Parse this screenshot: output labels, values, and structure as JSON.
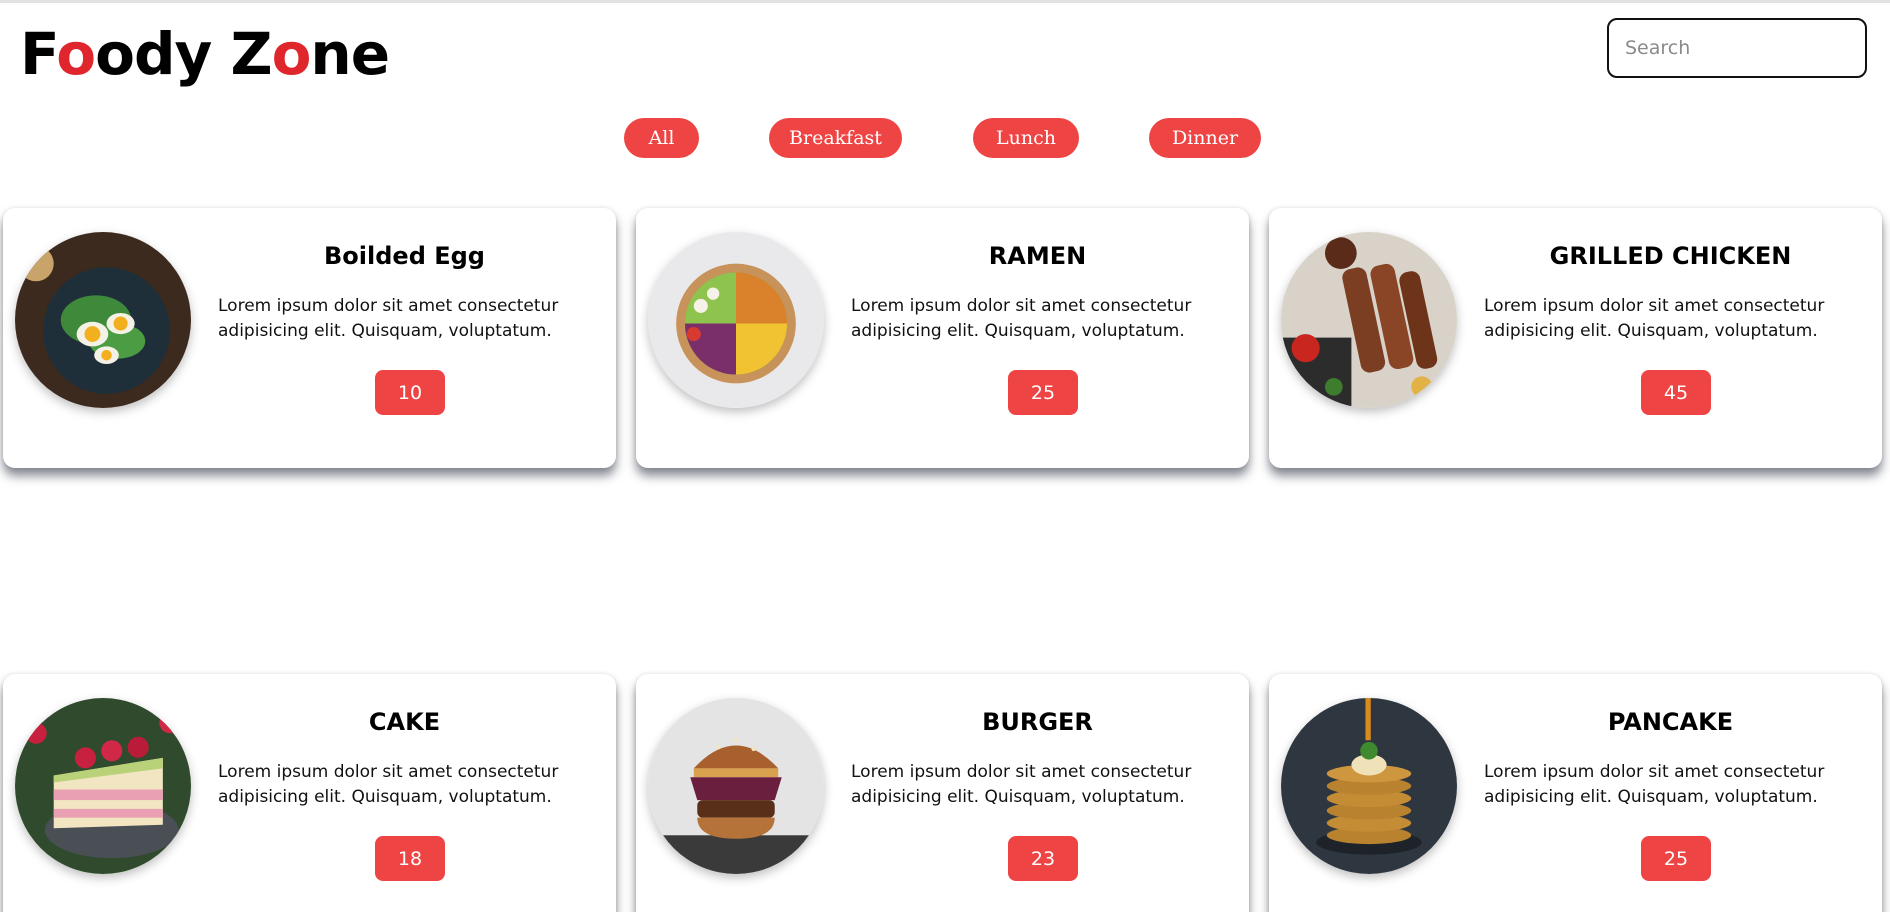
{
  "header": {
    "logo_parts": [
      "F",
      "o",
      "ody Z",
      "o",
      "ne"
    ],
    "search_placeholder": "Search"
  },
  "filters": [
    "All",
    "Breakfast",
    "Lunch",
    "Dinner"
  ],
  "cards": [
    {
      "title": "Boilded Egg",
      "description": "Lorem ipsum dolor sit amet consectetur adipisicing elit. Quisquam, voluptatum.",
      "price": "10",
      "image_icon": "boiled-egg-image"
    },
    {
      "title": "RAMEN",
      "description": "Lorem ipsum dolor sit amet consectetur adipisicing elit. Quisquam, voluptatum.",
      "price": "25",
      "image_icon": "salad-bowl-image"
    },
    {
      "title": "GRILLED CHICKEN",
      "description": "Lorem ipsum dolor sit amet consectetur adipisicing elit. Quisquam, voluptatum.",
      "price": "45",
      "image_icon": "grilled-chicken-image"
    },
    {
      "title": "CAKE",
      "description": "Lorem ipsum dolor sit amet consectetur adipisicing elit. Quisquam, voluptatum.",
      "price": "18",
      "image_icon": "cake-image"
    },
    {
      "title": "BURGER",
      "description": "Lorem ipsum dolor sit amet consectetur adipisicing elit. Quisquam, voluptatum.",
      "price": "23",
      "image_icon": "burger-image"
    },
    {
      "title": "PANCAKE",
      "description": "Lorem ipsum dolor sit amet consectetur adipisicing elit. Quisquam, voluptatum.",
      "price": "25",
      "image_icon": "pancake-image"
    }
  ],
  "colors": {
    "accent": "#ef4444",
    "logo_accent": "#e0262d"
  }
}
